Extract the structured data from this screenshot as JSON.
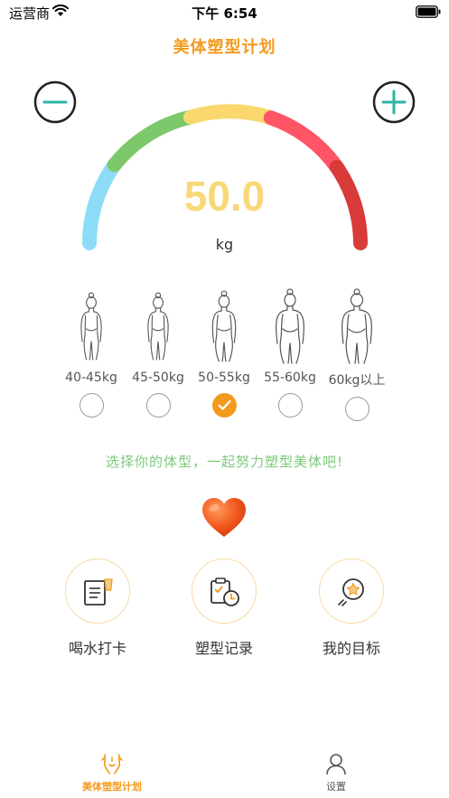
{
  "status_bar": {
    "carrier": "运营商",
    "time": "下午 6:54"
  },
  "header": {
    "title": "美体塑型计划"
  },
  "scale": {
    "value": "50.0",
    "unit": "kg",
    "value_color": "#F9D878"
  },
  "body_types": [
    {
      "label": "40-45kg",
      "selected": false
    },
    {
      "label": "45-50kg",
      "selected": false
    },
    {
      "label": "50-55kg",
      "selected": true
    },
    {
      "label": "55-60kg",
      "selected": false
    },
    {
      "label": "60kg以上",
      "selected": false
    }
  ],
  "tip": "选择你的体型，一起努力塑型美体吧!",
  "actions": [
    {
      "label": "喝水打卡",
      "icon": "water-card-icon"
    },
    {
      "label": "塑型记录",
      "icon": "clipboard-clock-icon"
    },
    {
      "label": "我的目标",
      "icon": "star-target-icon"
    }
  ],
  "tabbar": {
    "items": [
      {
        "label": "美体塑型计划",
        "icon": "body-shape-icon",
        "active": true
      },
      {
        "label": "设置",
        "icon": "person-icon",
        "active": false
      }
    ]
  },
  "colors": {
    "accent": "#F39A1E",
    "teal": "#2DB3A6",
    "tip_green": "#7CC97A",
    "gauge_blue": "#8DDCF7",
    "gauge_green": "#7CC86A",
    "gauge_yellow": "#FAD86E",
    "gauge_red": "#FF5566",
    "gauge_darkred": "#D93A3A"
  }
}
